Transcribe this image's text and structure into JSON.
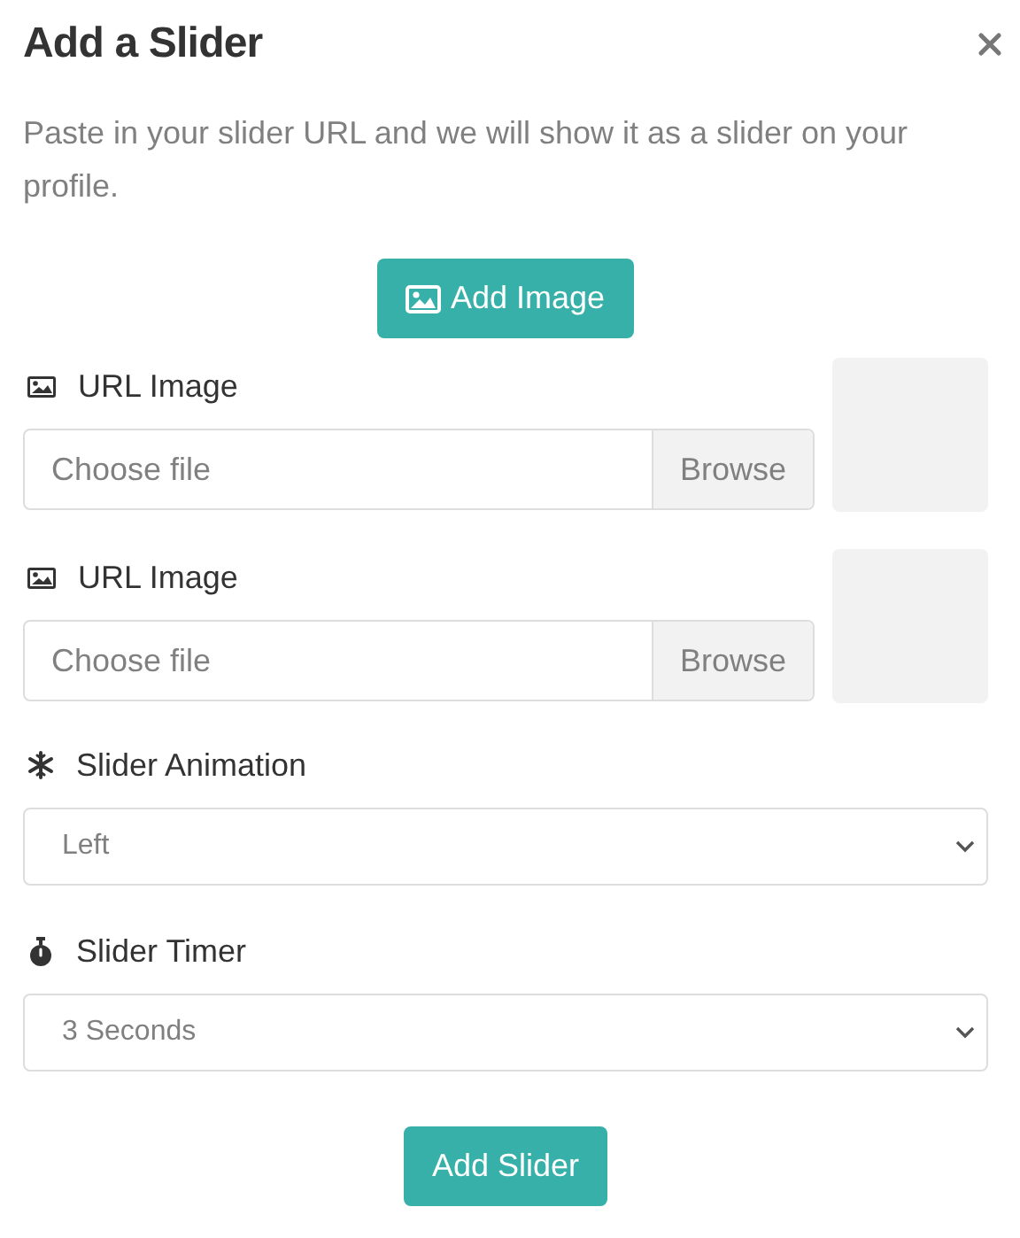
{
  "dialog": {
    "title": "Add a Slider",
    "description": "Paste in your slider URL and we will show it as a slider on your profile.",
    "add_image_button": "Add Image",
    "image_fields": [
      {
        "label": "URL Image",
        "placeholder": "Choose file",
        "browse": "Browse"
      },
      {
        "label": "URL Image",
        "placeholder": "Choose file",
        "browse": "Browse"
      }
    ],
    "selects": [
      {
        "kind": "animation",
        "label": "Slider Animation",
        "value": "Left"
      },
      {
        "kind": "timer",
        "label": "Slider Timer",
        "value": "3 Seconds"
      }
    ],
    "submit_button": "Add Slider"
  }
}
